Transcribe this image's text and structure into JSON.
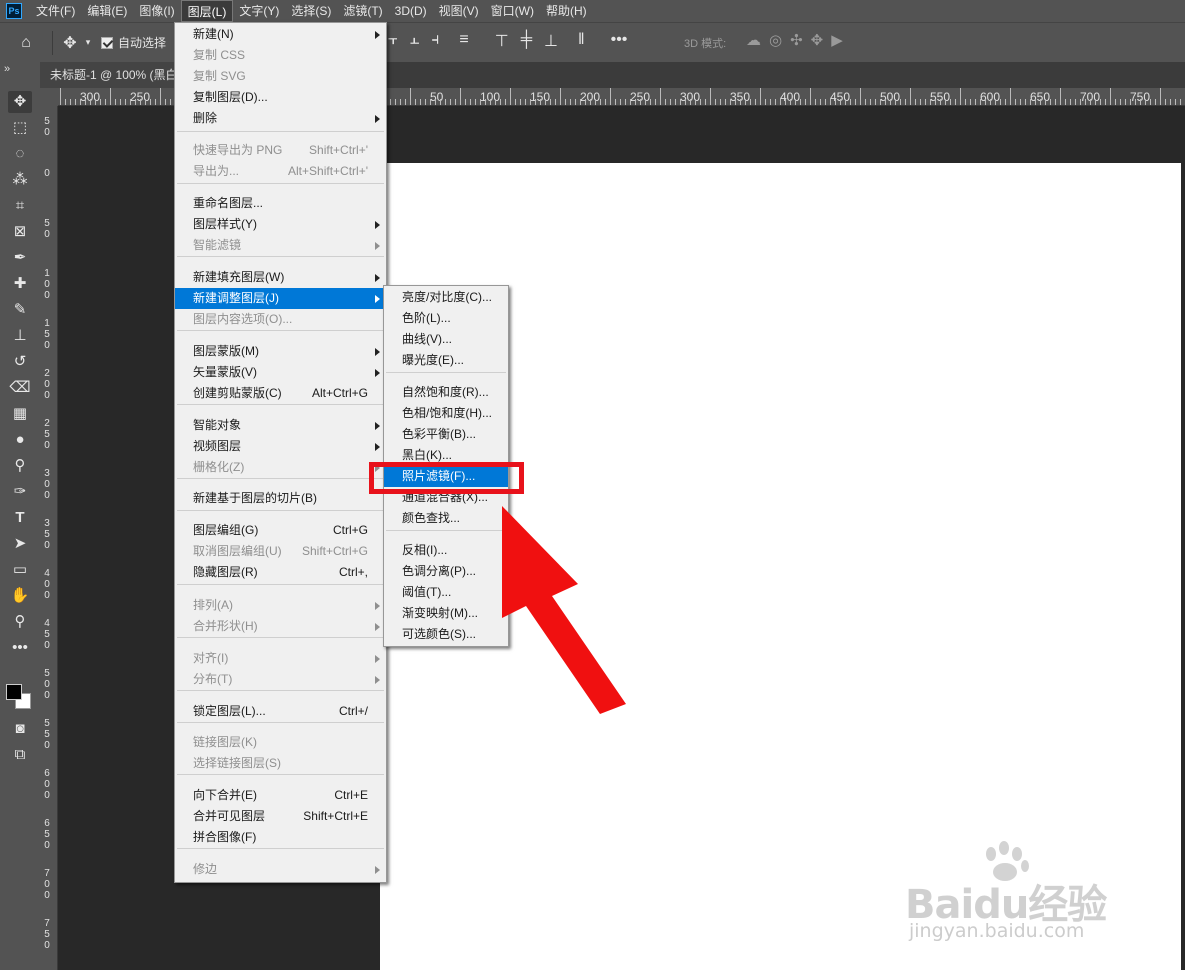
{
  "menubar": {
    "logo": "Ps",
    "items": [
      "文件(F)",
      "编辑(E)",
      "图像(I)",
      "图层(L)",
      "文字(Y)",
      "选择(S)",
      "滤镜(T)",
      "3D(D)",
      "视图(V)",
      "窗口(W)",
      "帮助(H)"
    ]
  },
  "options_bar": {
    "auto_select_label": "自动选择",
    "mode_3d_label": "3D 模式:"
  },
  "tab": {
    "title": "未标题-1 @ 100% (黑白"
  },
  "panel_collapse": "»",
  "ruler_top": [
    "300",
    "250",
    "50",
    "100",
    "150",
    "200",
    "250",
    "300",
    "350",
    "400",
    "450",
    "500",
    "550",
    "600",
    "650",
    "700",
    "750"
  ],
  "ruler_left": [
    "5 0",
    "0",
    "5 0",
    "1 0 0",
    "1 5 0",
    "2 0 0",
    "2 5 0",
    "3 0 0",
    "3 5 0",
    "4 0 0",
    "4 5 0",
    "5 0 0",
    "5 5 0",
    "6 0 0",
    "6 5 0",
    "7 0 0",
    "7 5 0"
  ],
  "layer_menu": {
    "items": [
      {
        "label": "新建(N)",
        "shortcut": "",
        "submenu": true,
        "disabled": false
      },
      {
        "label": "复制 CSS",
        "shortcut": "",
        "submenu": false,
        "disabled": true
      },
      {
        "label": "复制 SVG",
        "shortcut": "",
        "submenu": false,
        "disabled": true
      },
      {
        "label": "复制图层(D)...",
        "shortcut": "",
        "submenu": false,
        "disabled": false
      },
      {
        "label": "删除",
        "shortcut": "",
        "submenu": true,
        "disabled": false
      },
      {
        "label": "快速导出为 PNG",
        "shortcut": "Shift+Ctrl+'",
        "submenu": false,
        "disabled": true
      },
      {
        "label": "导出为...",
        "shortcut": "Alt+Shift+Ctrl+'",
        "submenu": false,
        "disabled": true
      },
      {
        "label": "重命名图层...",
        "shortcut": "",
        "submenu": false,
        "disabled": false
      },
      {
        "label": "图层样式(Y)",
        "shortcut": "",
        "submenu": true,
        "disabled": false
      },
      {
        "label": "智能滤镜",
        "shortcut": "",
        "submenu": true,
        "disabled": true
      },
      {
        "label": "新建填充图层(W)",
        "shortcut": "",
        "submenu": true,
        "disabled": false
      },
      {
        "label": "新建调整图层(J)",
        "shortcut": "",
        "submenu": true,
        "disabled": false
      },
      {
        "label": "图层内容选项(O)...",
        "shortcut": "",
        "submenu": false,
        "disabled": true
      },
      {
        "label": "图层蒙版(M)",
        "shortcut": "",
        "submenu": true,
        "disabled": false
      },
      {
        "label": "矢量蒙版(V)",
        "shortcut": "",
        "submenu": true,
        "disabled": false
      },
      {
        "label": "创建剪贴蒙版(C)",
        "shortcut": "Alt+Ctrl+G",
        "submenu": false,
        "disabled": false
      },
      {
        "label": "智能对象",
        "shortcut": "",
        "submenu": true,
        "disabled": false
      },
      {
        "label": "视频图层",
        "shortcut": "",
        "submenu": true,
        "disabled": false
      },
      {
        "label": "栅格化(Z)",
        "shortcut": "",
        "submenu": true,
        "disabled": true
      },
      {
        "label": "新建基于图层的切片(B)",
        "shortcut": "",
        "submenu": false,
        "disabled": false
      },
      {
        "label": "图层编组(G)",
        "shortcut": "Ctrl+G",
        "submenu": false,
        "disabled": false
      },
      {
        "label": "取消图层编组(U)",
        "shortcut": "Shift+Ctrl+G",
        "submenu": false,
        "disabled": true
      },
      {
        "label": "隐藏图层(R)",
        "shortcut": "Ctrl+,",
        "submenu": false,
        "disabled": false
      },
      {
        "label": "排列(A)",
        "shortcut": "",
        "submenu": true,
        "disabled": true
      },
      {
        "label": "合并形状(H)",
        "shortcut": "",
        "submenu": true,
        "disabled": true
      },
      {
        "label": "对齐(I)",
        "shortcut": "",
        "submenu": true,
        "disabled": true
      },
      {
        "label": "分布(T)",
        "shortcut": "",
        "submenu": true,
        "disabled": true
      },
      {
        "label": "锁定图层(L)...",
        "shortcut": "Ctrl+/",
        "submenu": false,
        "disabled": false
      },
      {
        "label": "链接图层(K)",
        "shortcut": "",
        "submenu": false,
        "disabled": true
      },
      {
        "label": "选择链接图层(S)",
        "shortcut": "",
        "submenu": false,
        "disabled": true
      },
      {
        "label": "向下合并(E)",
        "shortcut": "Ctrl+E",
        "submenu": false,
        "disabled": false
      },
      {
        "label": "合并可见图层",
        "shortcut": "Shift+Ctrl+E",
        "submenu": false,
        "disabled": false
      },
      {
        "label": "拼合图像(F)",
        "shortcut": "",
        "submenu": false,
        "disabled": false
      },
      {
        "label": "修边",
        "shortcut": "",
        "submenu": true,
        "disabled": true
      }
    ]
  },
  "adjust_submenu": {
    "items": [
      {
        "label": "亮度/对比度(C)..."
      },
      {
        "label": "色阶(L)..."
      },
      {
        "label": "曲线(V)..."
      },
      {
        "label": "曝光度(E)..."
      },
      {
        "label": "自然饱和度(R)..."
      },
      {
        "label": "色相/饱和度(H)..."
      },
      {
        "label": "色彩平衡(B)..."
      },
      {
        "label": "黑白(K)..."
      },
      {
        "label": "照片滤镜(F)..."
      },
      {
        "label": "通道混合器(X)..."
      },
      {
        "label": "颜色查找..."
      },
      {
        "label": "反相(I)..."
      },
      {
        "label": "色调分离(P)..."
      },
      {
        "label": "阈值(T)..."
      },
      {
        "label": "渐变映射(M)..."
      },
      {
        "label": "可选颜色(S)..."
      }
    ]
  },
  "watermark": {
    "main": "Baidu经验",
    "sub": "jingyan.baidu.com"
  },
  "colors": {
    "highlight": "#0078d7",
    "annotation_red": "#e8121b",
    "chrome": "#535353",
    "workspace": "#282828"
  }
}
